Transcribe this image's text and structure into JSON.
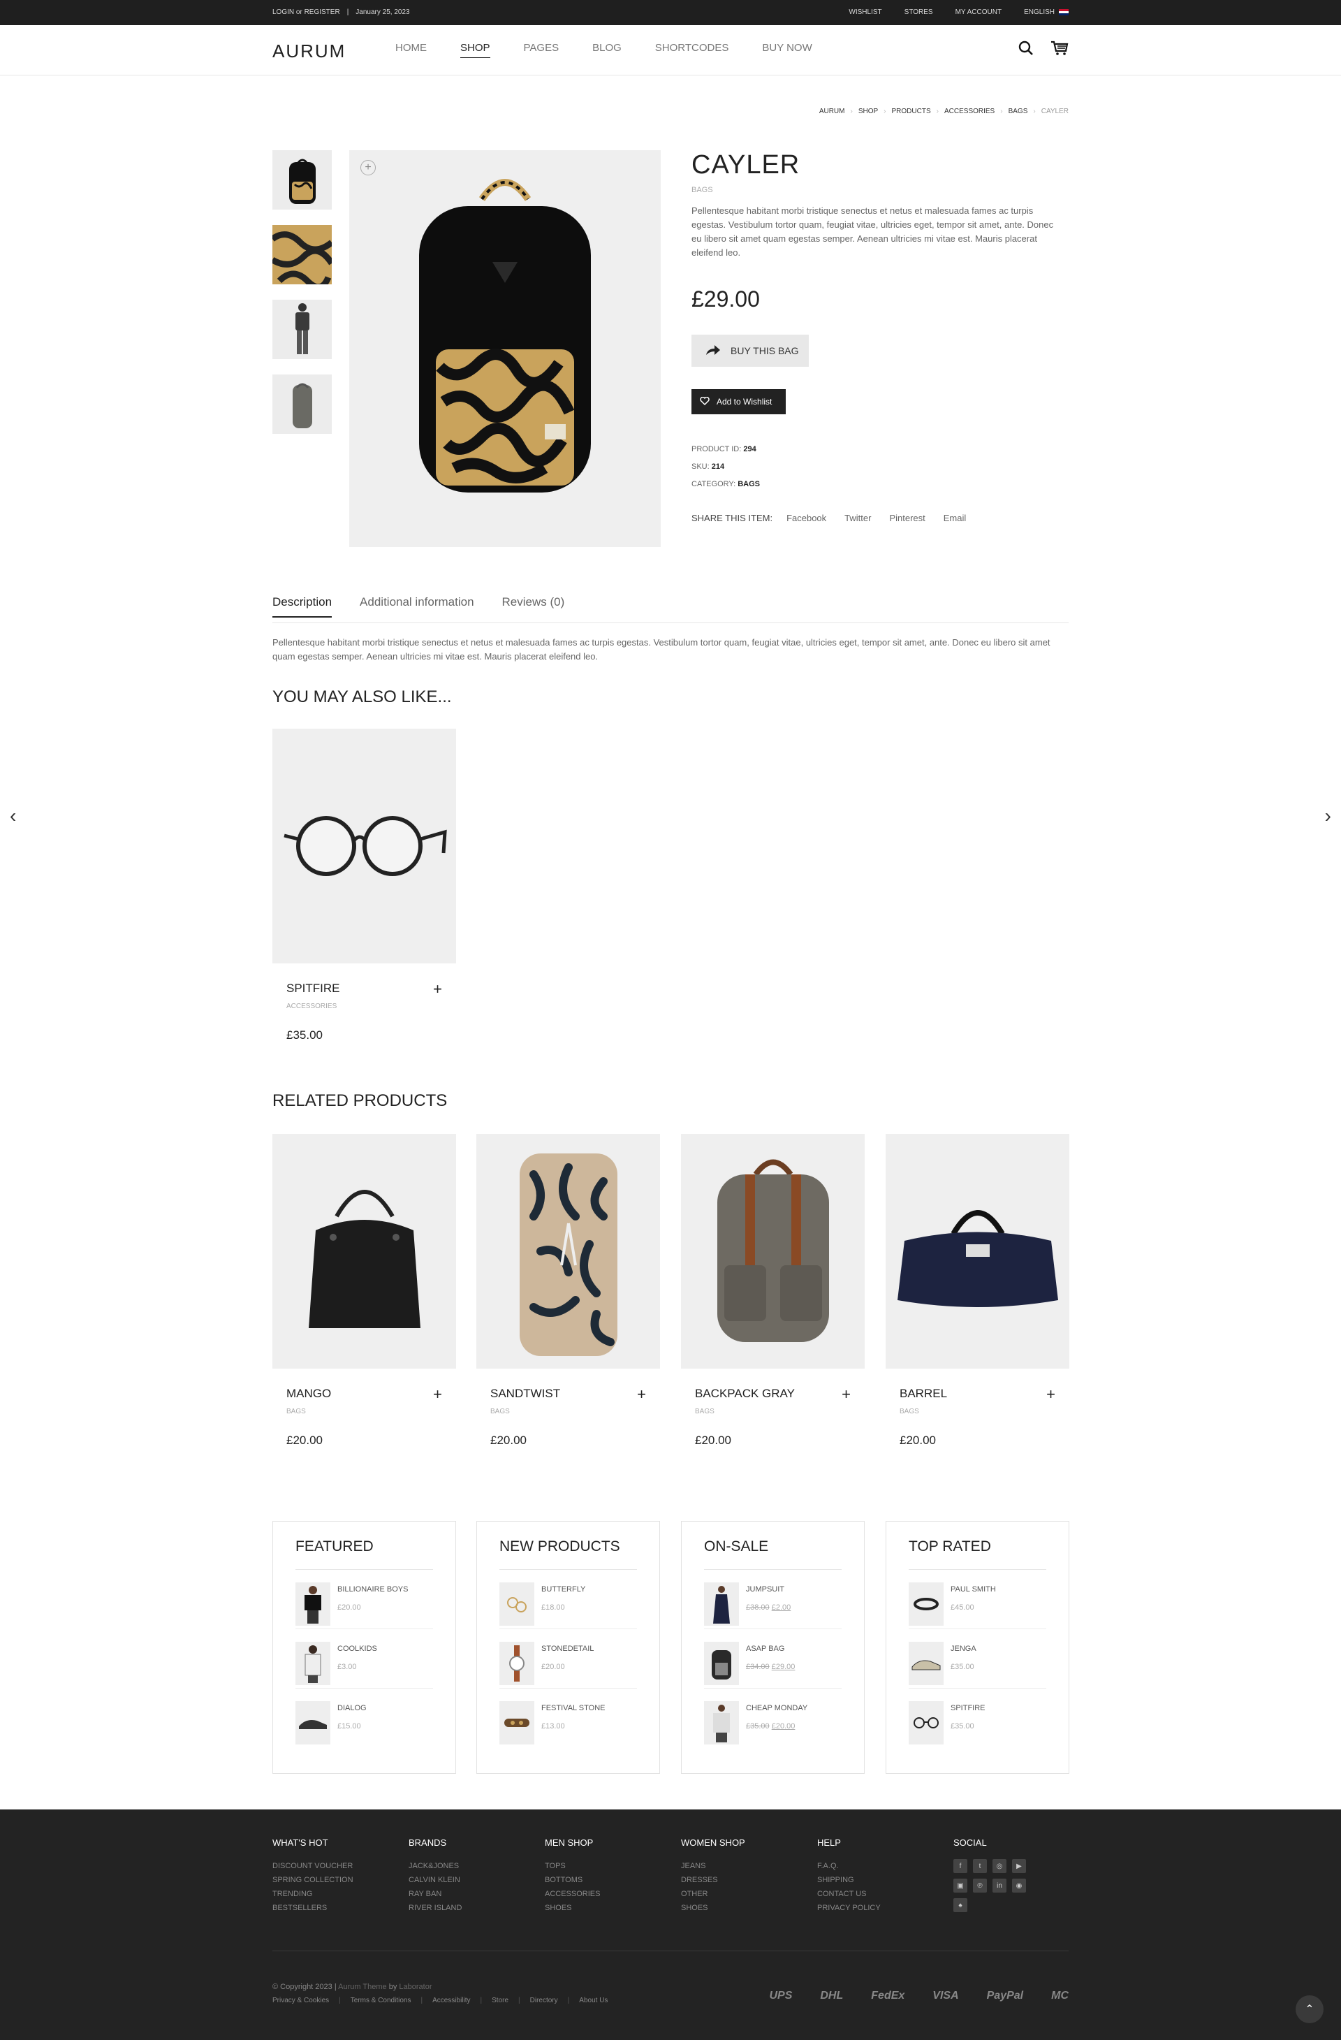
{
  "topbar": {
    "login": "LOGIN or REGISTER",
    "sep": "|",
    "date": "January 25, 2023",
    "wishlist": "WISHLIST",
    "stores": "STORES",
    "my_account": "MY ACCOUNT",
    "language": "ENGLISH"
  },
  "header": {
    "logo": "AURUM",
    "nav": [
      "HOME",
      "SHOP",
      "PAGES",
      "BLOG",
      "SHORTCODES",
      "BUY NOW"
    ],
    "search_icon": "search-icon",
    "cart_icon": "cart-icon"
  },
  "breadcrumbs": [
    "AURUM",
    "SHOP",
    "PRODUCTS",
    "ACCESSORIES",
    "BAGS",
    "CAYLER"
  ],
  "breadcrumb_sep": "›",
  "product": {
    "title": "CAYLER",
    "category": "BAGS",
    "description": "Pellentesque habitant morbi tristique senectus et netus et malesuada fames ac turpis egestas. Vestibulum tortor quam, feugiat vitae, ultricies eget, tempor sit amet, ante. Donec eu libero sit amet quam egestas semper. Aenean ultricies mi vitae est. Mauris placerat eleifend leo.",
    "price": "£29.00",
    "buy_label": "BUY THIS BAG",
    "wishlist_label": "Add to Wishlist",
    "meta": {
      "id_label": "PRODUCT ID:",
      "id_value": "294",
      "sku_label": "SKU:",
      "sku_value": "214",
      "category_label": "CATEGORY:",
      "category_value": "BAGS"
    },
    "share": {
      "label": "SHARE THIS ITEM:",
      "links": [
        "Facebook",
        "Twitter",
        "Pinterest",
        "Email"
      ]
    }
  },
  "tabs": {
    "items": [
      "Description",
      "Additional information",
      "Reviews (0)"
    ],
    "content": "Pellentesque habitant morbi tristique senectus et netus et malesuada fames ac turpis egestas. Vestibulum tortor quam, feugiat vitae, ultricies eget, tempor sit amet, ante. Donec eu libero sit amet quam egestas semper. Aenean ultricies mi vitae est. Mauris placerat eleifend leo."
  },
  "upsells": {
    "title": "YOU MAY ALSO LIKE...",
    "items": [
      {
        "name": "SPITFIRE",
        "category": "ACCESSORIES",
        "price": "£35.00"
      }
    ]
  },
  "related": {
    "title": "RELATED PRODUCTS",
    "items": [
      {
        "name": "MANGO",
        "category": "BAGS",
        "price": "£20.00"
      },
      {
        "name": "SANDTWIST",
        "category": "BAGS",
        "price": "£20.00"
      },
      {
        "name": "BACKPACK GRAY",
        "category": "BAGS",
        "price": "£20.00"
      },
      {
        "name": "BARREL",
        "category": "BAGS",
        "price": "£20.00"
      }
    ]
  },
  "widgets": [
    {
      "title": "FEATURED",
      "items": [
        {
          "name": "BILLIONAIRE BOYS",
          "price": "£20.00"
        },
        {
          "name": "COOLKIDS",
          "price": "£3.00"
        },
        {
          "name": "DIALOG",
          "price": "£15.00"
        }
      ]
    },
    {
      "title": "NEW PRODUCTS",
      "items": [
        {
          "name": "BUTTERFLY",
          "price": "£18.00"
        },
        {
          "name": "STONEDETAIL",
          "price": "£20.00"
        },
        {
          "name": "FESTIVAL STONE",
          "price": "£13.00"
        }
      ]
    },
    {
      "title": "ON-SALE",
      "items": [
        {
          "name": "JUMPSUIT",
          "old_price": "£38.00",
          "price": "£2.00"
        },
        {
          "name": "ASAP BAG",
          "old_price": "£34.00",
          "price": "£29.00"
        },
        {
          "name": "CHEAP MONDAY",
          "old_price": "£35.00",
          "price": "£20.00"
        }
      ]
    },
    {
      "title": "TOP RATED",
      "items": [
        {
          "name": "PAUL SMITH",
          "price": "£45.00"
        },
        {
          "name": "JENGA",
          "price": "£35.00"
        },
        {
          "name": "SPITFIRE",
          "price": "£35.00"
        }
      ]
    }
  ],
  "footer": {
    "columns": [
      {
        "title": "WHAT'S HOT",
        "links": [
          "DISCOUNT VOUCHER",
          "SPRING COLLECTION",
          "TRENDING",
          "BESTSELLERS"
        ]
      },
      {
        "title": "BRANDS",
        "links": [
          "JACK&JONES",
          "CALVIN KLEIN",
          "RAY BAN",
          "RIVER ISLAND"
        ]
      },
      {
        "title": "MEN SHOP",
        "links": [
          "TOPS",
          "BOTTOMS",
          "ACCESSORIES",
          "SHOES"
        ]
      },
      {
        "title": "WOMEN SHOP",
        "links": [
          "JEANS",
          "DRESSES",
          "OTHER",
          "SHOES"
        ]
      },
      {
        "title": "HELP",
        "links": [
          "F.A.Q.",
          "SHIPPING",
          "CONTACT US",
          "PRIVACY POLICY"
        ]
      }
    ],
    "social_title": "SOCIAL",
    "social_icons": [
      "f",
      "t",
      "◎",
      "▶",
      "▣",
      "℗",
      "in",
      "◉",
      "♠"
    ],
    "copyright_pre": "© Copyright 2023 |",
    "copyright_theme": "Aurum Theme",
    "copyright_by": "by",
    "copyright_author": "Laborator",
    "bottom_links": [
      "Privacy & Cookies",
      "Terms & Conditions",
      "Accessibility",
      "Store",
      "Directory",
      "About Us"
    ],
    "payments": [
      "UPS",
      "DHL",
      "FedEx",
      "VISA",
      "PayPal",
      "MC"
    ]
  },
  "colors": {
    "topbar_bg": "#1f1f1f",
    "footer_bg": "#232323",
    "text_dark": "#222222"
  }
}
